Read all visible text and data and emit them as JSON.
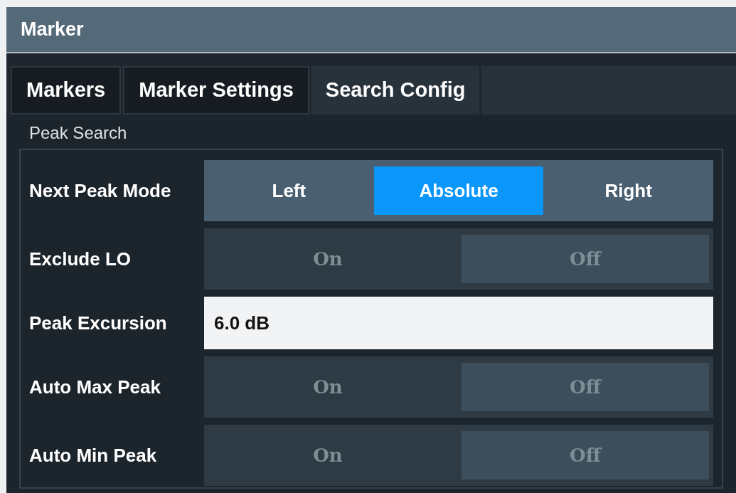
{
  "window": {
    "title": "Marker"
  },
  "tabs": [
    {
      "label": "Markers",
      "selected": false
    },
    {
      "label": "Marker Settings",
      "selected": false
    },
    {
      "label": "Search Config",
      "selected": true
    }
  ],
  "group": {
    "title": "Peak Search",
    "rows": [
      {
        "kind": "segmented",
        "label": "Next Peak Mode",
        "options": [
          {
            "label": "Left",
            "selected": false
          },
          {
            "label": "Absolute",
            "selected": true
          },
          {
            "label": "Right",
            "selected": false
          }
        ]
      },
      {
        "kind": "toggle",
        "label": "Exclude LO",
        "options": [
          {
            "label": "On",
            "selected": false
          },
          {
            "label": "Off",
            "selected": true
          }
        ]
      },
      {
        "kind": "field",
        "label": "Peak Excursion",
        "value": "6.0 dB"
      },
      {
        "kind": "toggle",
        "label": "Auto Max Peak",
        "options": [
          {
            "label": "On",
            "selected": false
          },
          {
            "label": "Off",
            "selected": true
          }
        ]
      },
      {
        "kind": "toggle",
        "label": "Auto Min Peak",
        "options": [
          {
            "label": "On",
            "selected": false
          },
          {
            "label": "Off",
            "selected": true
          }
        ]
      }
    ]
  }
}
